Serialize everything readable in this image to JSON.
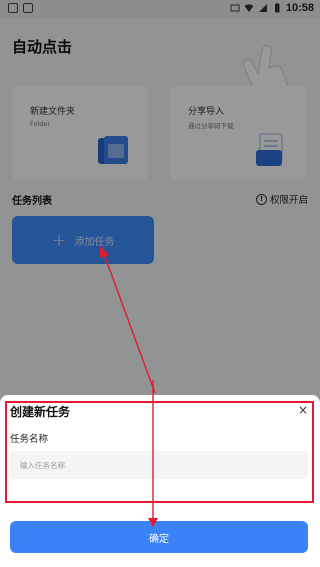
{
  "status_bar": {
    "time": "10:58"
  },
  "app": {
    "title": "自动点击",
    "cards": [
      {
        "title": "新建文件夹",
        "subtitle": "Folder"
      },
      {
        "title": "分享导入",
        "subtitle": "通过分享码下载"
      }
    ],
    "task_list_title": "任务列表",
    "permission_label": "权限开启",
    "add_task_label": "添加任务"
  },
  "sheet": {
    "title": "创建新任务",
    "close": "×",
    "name_label": "任务名称",
    "name_placeholder": "输入任务名称",
    "name_value": "",
    "confirm_label": "确定"
  },
  "colors": {
    "accent": "#3b82f6",
    "annotation": "#e11d2b"
  }
}
